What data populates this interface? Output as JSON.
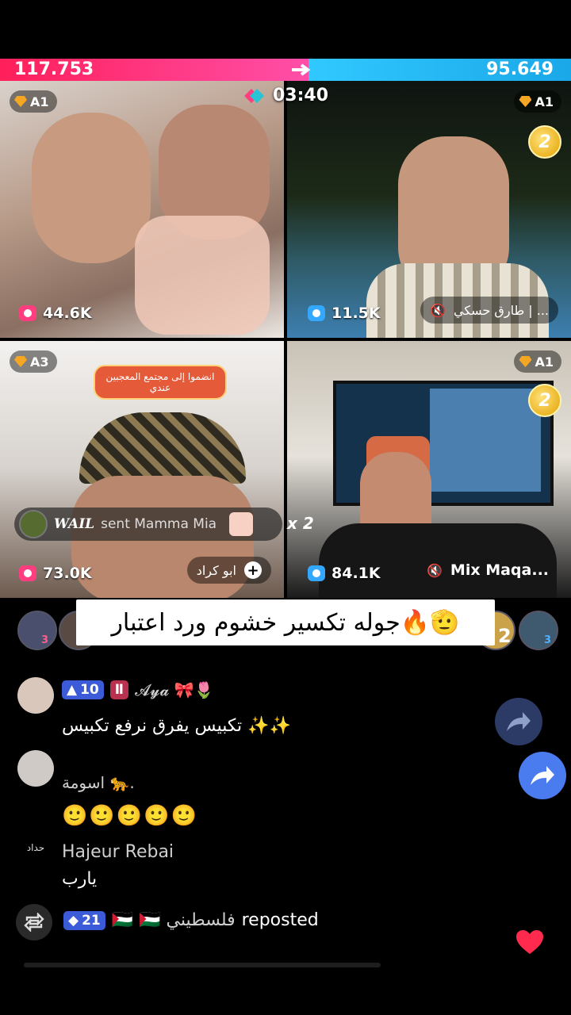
{
  "battle": {
    "score_left": "117.753",
    "score_right": "95.649",
    "timer": "03:40",
    "colors": {
      "left": "#ff1f5a",
      "right": "#31c8ff"
    }
  },
  "tiles": [
    {
      "level": "A1",
      "viewers": "44.6K",
      "name": ""
    },
    {
      "level": "A1",
      "viewers": "11.5K",
      "name": "طارق حسكي | ...",
      "rank": "2"
    },
    {
      "level": "A3",
      "viewers": "73.0K",
      "name": "ابو كراد",
      "banner": "انضموا إلى مجتمع المعجبين عندي"
    },
    {
      "level": "A1",
      "viewers": "84.1K",
      "name": "Mix  Maqa...",
      "rank": "2"
    }
  ],
  "gift": {
    "user": "WAIL",
    "text": "sent Mamma Mia",
    "count": "x 2"
  },
  "caption": "جوله تكسير خشوم ورد اعتبار🔥🫡",
  "viewer_avatars": [
    {
      "badge": "3"
    },
    {
      "badge": "2"
    },
    {
      "badge": "3"
    }
  ],
  "comments": [
    {
      "badges": [
        {
          "type": "blue",
          "value": "10"
        },
        {
          "type": "red",
          "value": ""
        }
      ],
      "name": "𝓐𝔂𝓪 🎀🌷",
      "text": "تكبيس يفرق نرفع تكبيس ✨✨"
    },
    {
      "badges": [],
      "name": "اسومة 🐆.",
      "text": "🙂🙂🙂🙂🙂"
    },
    {
      "badges": [],
      "name": "Hajeur Rebai",
      "text": "يارب",
      "avatar_label": "حداد"
    },
    {
      "badges": [
        {
          "type": "blue",
          "value": "21"
        }
      ],
      "name": "🇵🇸 🇵🇸 فلسطيني",
      "text": "reposted"
    }
  ],
  "icons": {
    "share": "share-arrow-icon",
    "repost": "repost-icon",
    "heart": "heart-icon",
    "close": "close-plus-icon",
    "mute": "mute-icon"
  }
}
